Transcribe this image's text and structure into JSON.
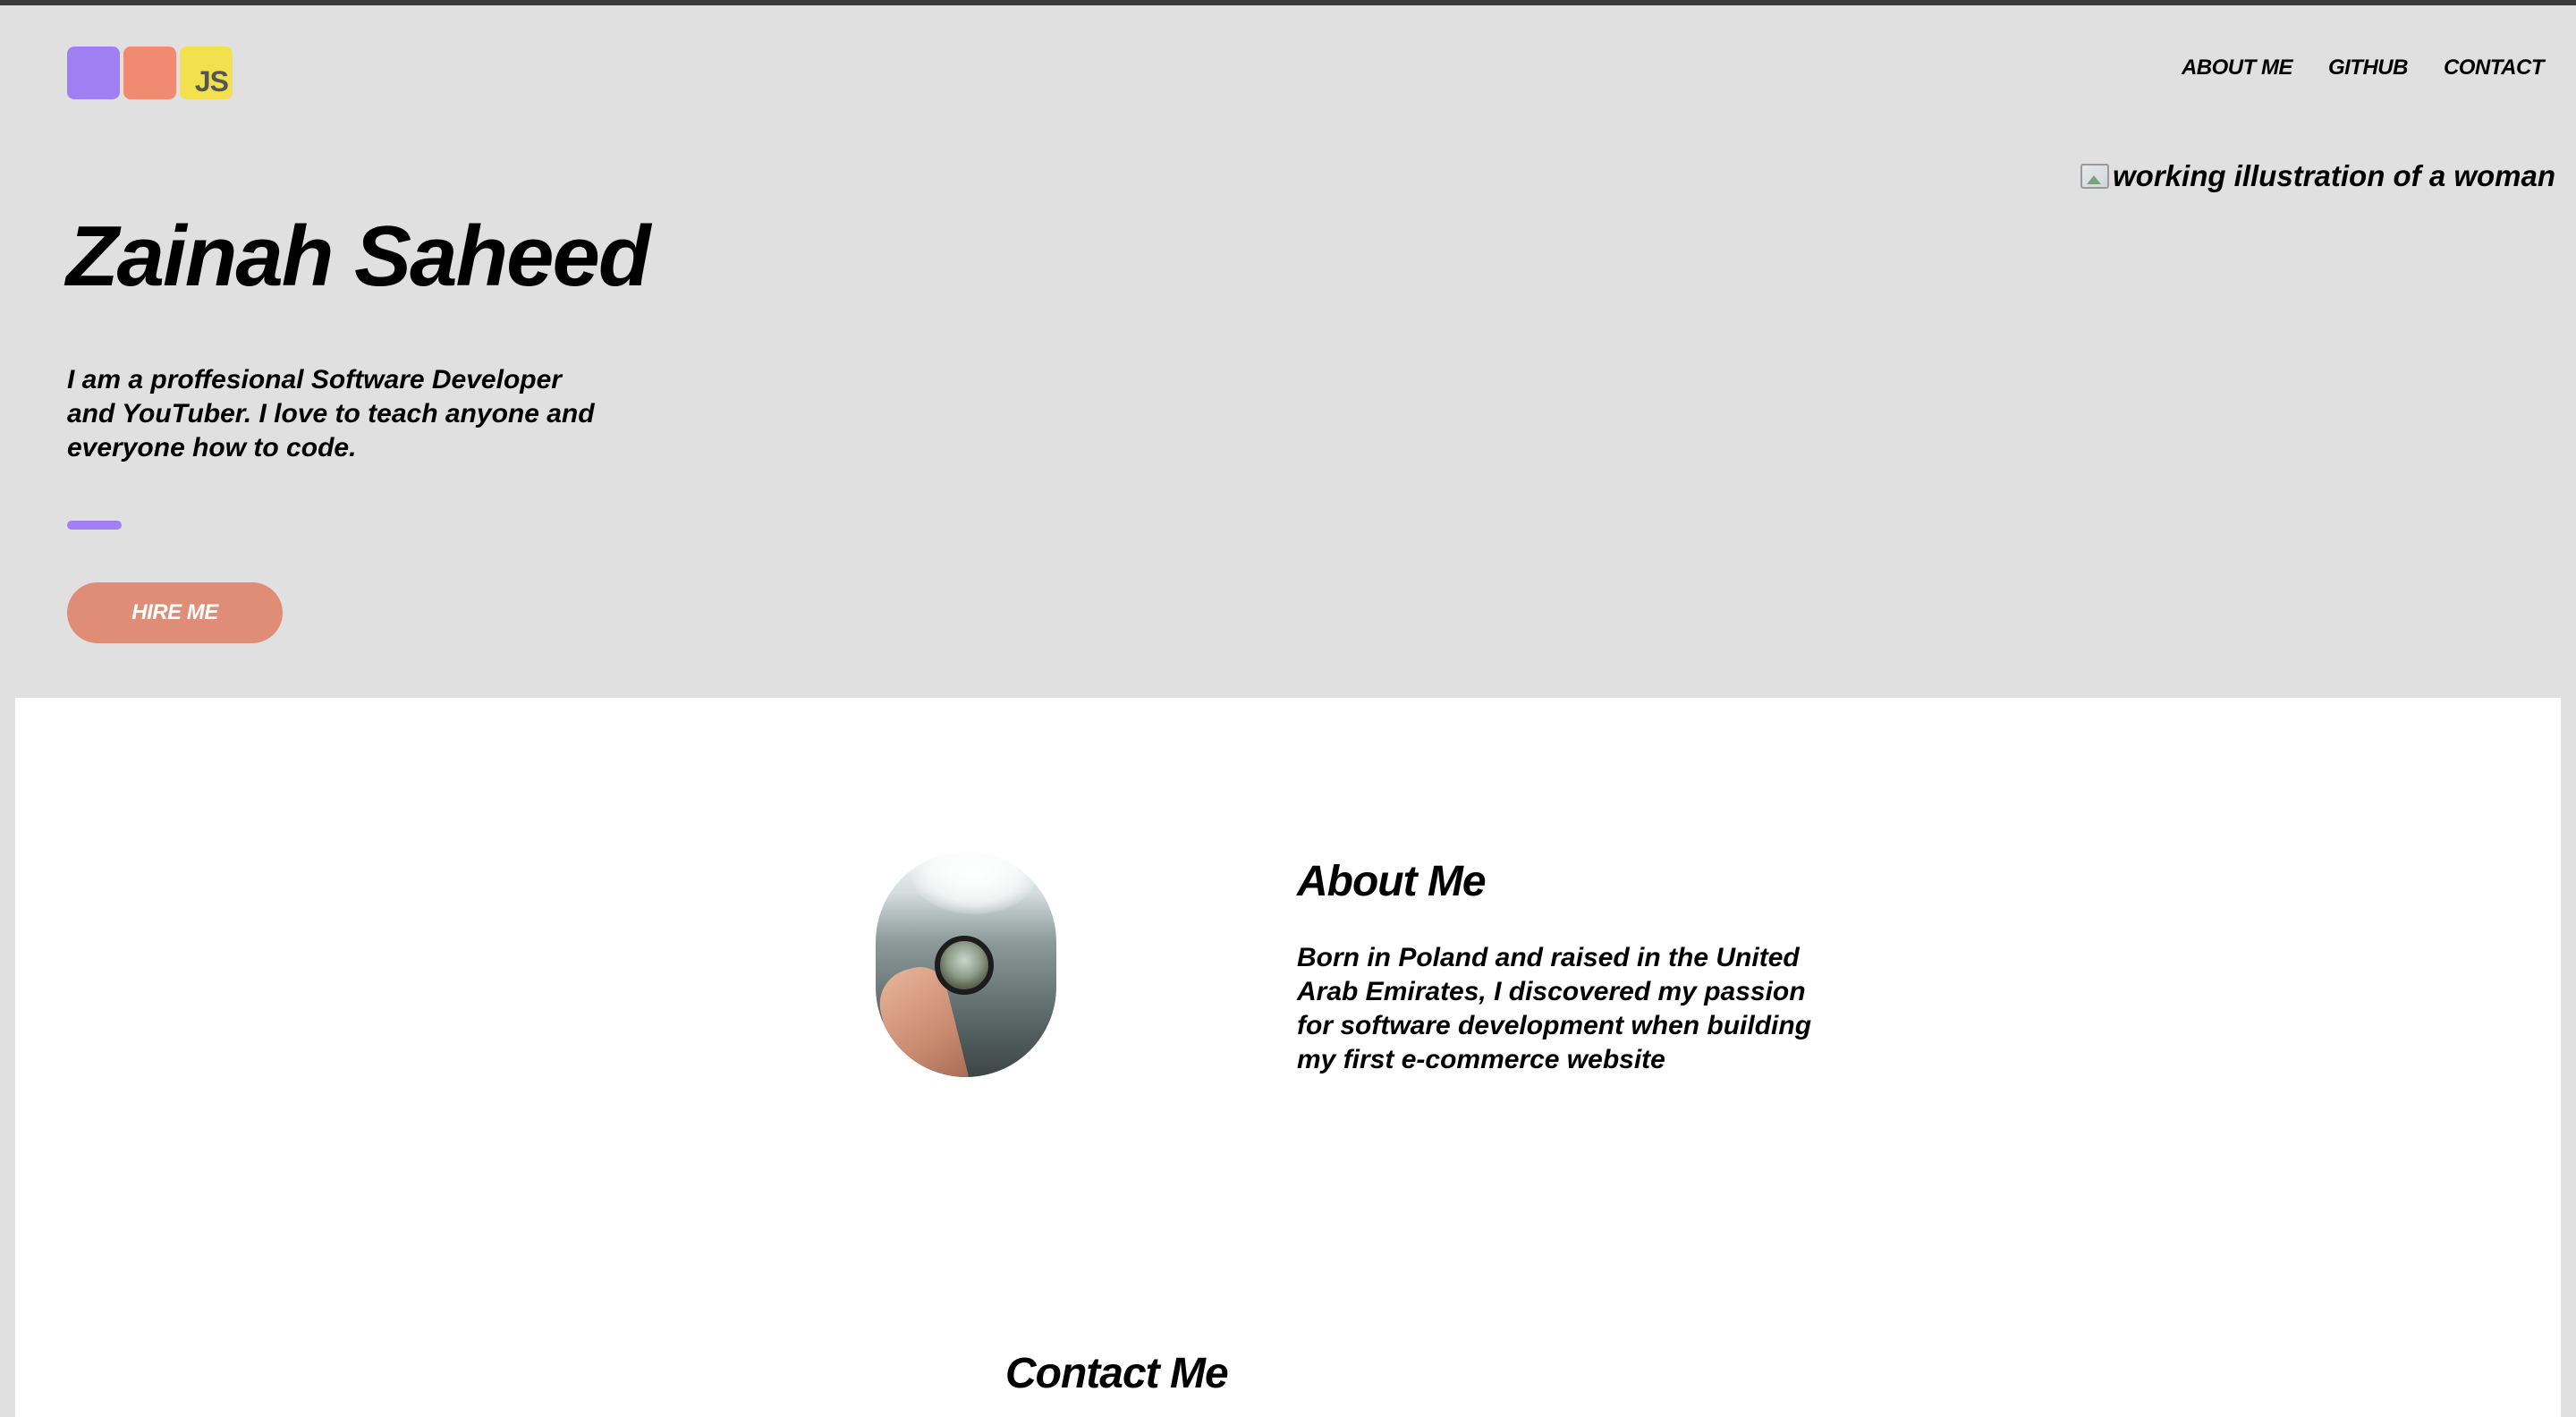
{
  "header": {
    "logo": {
      "text": "JS",
      "colors": [
        "#a07ff2",
        "#f08a70",
        "#f2e04e"
      ]
    },
    "nav": [
      {
        "label": "ABOUT ME"
      },
      {
        "label": "GITHUB"
      },
      {
        "label": "CONTACT"
      }
    ]
  },
  "hero": {
    "image_alt": "working illustration of a woman",
    "title": "Zainah Saheed",
    "description": "I am a proffesional Software Developer and YouTuber. I love to teach anyone and everyone how to code.",
    "accent_color": "#a07ff2",
    "cta_label": "HIRE ME",
    "cta_color": "#e08d78"
  },
  "about": {
    "title": "About Me",
    "text": "Born in Poland and raised in the United Arab Emirates, I discovered my passion for software development when building my first e-commerce website"
  },
  "contact": {
    "title": "Contact Me"
  }
}
